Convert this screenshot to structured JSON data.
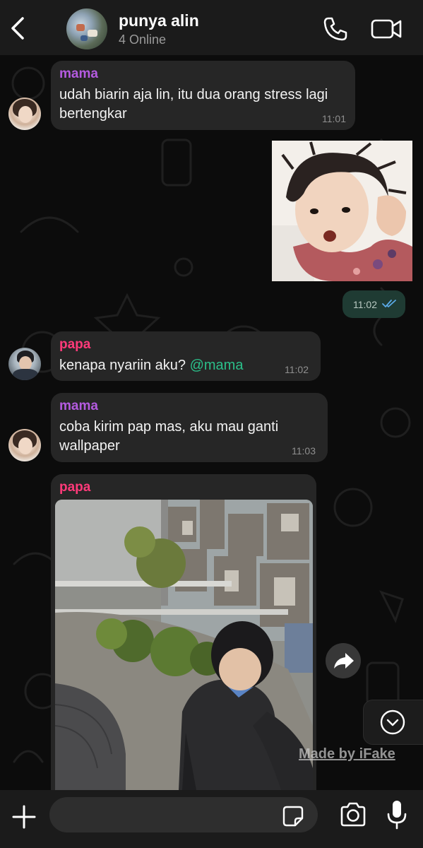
{
  "header": {
    "title": "punya alin",
    "subtitle": "4 Online"
  },
  "messages": [
    {
      "sender": "mama",
      "text": "udah biarin aja lin, itu dua orang stress lagi bertengkar",
      "time": "11:01"
    },
    {
      "type": "outgoing-image",
      "time": "11:02"
    },
    {
      "sender": "papa",
      "text": "kenapa nyariin aku?",
      "mention": "@mama",
      "time": "11:02"
    },
    {
      "sender": "mama",
      "text": "coba kirim pap mas, aku mau ganti wallpaper",
      "time": "11:03"
    },
    {
      "sender": "papa",
      "type": "image"
    }
  ],
  "watermark": "Made by iFake",
  "input": {
    "placeholder": ""
  },
  "colors": {
    "mama_name": "#b45be0",
    "papa_name": "#ff3a7a",
    "mention": "#2bbf8a",
    "outgoing_bubble": "#1f3b33",
    "read_ticks": "#5aa9e6"
  },
  "icons": [
    "back-icon",
    "phone-icon",
    "video-icon",
    "forward-icon",
    "chevron-down-icon",
    "plus-icon",
    "sticker-icon",
    "camera-icon",
    "mic-icon",
    "double-check-icon"
  ]
}
